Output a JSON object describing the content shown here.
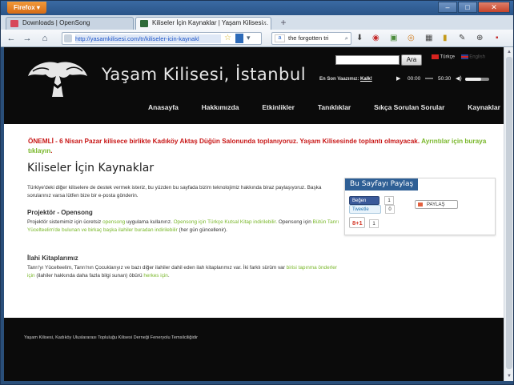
{
  "browser": {
    "app_button": "Firefox ▾",
    "window_controls": {
      "minimize": "–",
      "maximize": "□",
      "close": "✕"
    },
    "tabs": [
      {
        "title": "Downloads | OpenSong"
      },
      {
        "title": "Kiliseler İçin Kaynaklar | Yaşam Kilisesi..."
      }
    ],
    "tab_close": "×",
    "new_tab": "+",
    "url": "http://yasamkilisesi.com/tr/kiliseler-icin-kaynakl",
    "search_engine_label": "a",
    "search_value": "the forgotten tri",
    "icons": {
      "back": "←",
      "forward": "→",
      "home": "⌂",
      "star": "☆",
      "go": "▾",
      "search": "⌕",
      "download": "⬇",
      "ext_1": "◉",
      "ext_2": "▣",
      "ext_3": "◎",
      "ext_4": "▦",
      "ext_5": "▮",
      "ext_6": "✎",
      "ext_7": "⊕",
      "ext_8": "▪"
    }
  },
  "site": {
    "title": "Yaşam Kilisesi, İstanbul",
    "search_button": "Ara",
    "languages": {
      "current": "Türkçe",
      "other": "English"
    },
    "last_sermon_label": "En Son Vaazımız:",
    "last_sermon_link": "Kalk!",
    "player": {
      "play": "▶",
      "current": "00:00",
      "duration": "50:30",
      "volume_icon": "◀)",
      "volume_level": 0.67
    },
    "nav": [
      "Anasayfa",
      "Hakkımızda",
      "Etkinlikler",
      "Tanıklıklar",
      "Sıkça Sorulan Sorular",
      "Kaynaklar"
    ]
  },
  "alert": {
    "text": "ÖNEMLİ - 6 Nisan Pazar kilisece birlikte Kadıköy Aktaş Düğün Salonunda toplanıyoruz. Yaşam Kilisesinde toplantı olmayacak.",
    "link": "Ayrıntılar için buraya tıklayın",
    "end": "."
  },
  "content": {
    "title": "Kiliseler İçin Kaynaklar",
    "intro": "Türkiye'deki diğer kiliselere de destek vermek isteriz, bu yüzden bu sayfada bizim teknolojimiz hakkında biraz paylaşıyoruz. Başka sorularınız varsa lütfen bize bir e-posta gönderin.",
    "projector": {
      "heading": "Projektör - Opensong",
      "p1": "Projektör sistemimiz için ücretsiz ",
      "l1": "opensong",
      "p2": " uygulama kullanırız. ",
      "l2": "Opensong için Türkçe Kutsal Kitap indirilebilir.",
      "p3": " Opensong için ",
      "l3": "Bütün Tanrı Yücelteelim'de bulunan ve birkaç başka ilahiler buradan indirilebilir",
      "p4": " (her gün güncellenir)."
    },
    "hymns": {
      "heading": "İlahi Kitaplarımız",
      "p1": "Tanrı'yı Yücelteelim, Tanrı'nın Çocuklarıyız ve bazı diğer ilahiler dahil eden ilah kitaplarımız var. İki farklı sürüm var ",
      "l1": "birisi tapınma önderler için",
      "p2": " (ilahiler hakkında daha fazla bilgi sunan) öbürü ",
      "l2": "herkes için",
      "p3": "."
    }
  },
  "share": {
    "title": "Bu Sayfayı Paylaş",
    "facebook": "Beğen",
    "facebook_count": "1",
    "twitter": "Tweetle",
    "twitter_count": "0",
    "google": "8+1",
    "google_count": "1",
    "generic": "PAYLAŞ"
  },
  "footer": {
    "text": "Yaşam Kilisesi, Kadıköy Uluslararası Topluluğu Kilisesi Derneği Feneryolu Temsilciliğidir"
  },
  "colors": {
    "alert_red": "#c81717",
    "link_green": "#79b72a",
    "share_header": "#2e5f95",
    "header_bg": "#0b0b0b"
  }
}
